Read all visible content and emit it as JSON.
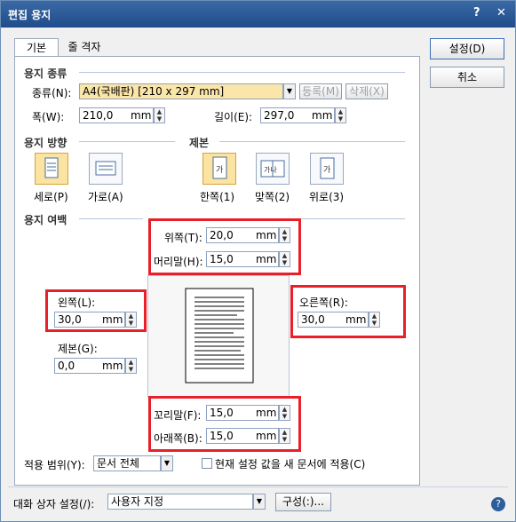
{
  "window": {
    "title": "편집 용지",
    "help_glyph": "?",
    "close_glyph": "✕"
  },
  "tabs": {
    "basic": "기본",
    "grid": "줄 격자"
  },
  "buttons": {
    "ok": "설정(D)",
    "cancel": "취소",
    "register": "등록(M)",
    "delete": "삭제(X)",
    "config": "구성(:)..."
  },
  "paper_type": {
    "section_title": "용지 종류",
    "kind_label": "종류(N):",
    "kind_value": "A4(국배판) [210 x 297 mm]",
    "width_label": "폭(W):",
    "width_value": "210,0",
    "height_label": "길이(E):",
    "height_value": "297,0",
    "unit": "mm"
  },
  "orientation": {
    "section_title": "용지 방향",
    "portrait": "세로(P)",
    "landscape": "가로(A)",
    "portrait_icon": "portrait-page-icon",
    "landscape_icon": "landscape-page-icon"
  },
  "binding": {
    "section_title": "제본",
    "single": "한쪽(1)",
    "facing": "맞쪽(2)",
    "top": "위로(3)",
    "single_glyph": "가",
    "facing_glyph": "가나",
    "top_glyph": "가"
  },
  "margins": {
    "section_title": "용지 여백",
    "top_label": "위쪽(T):",
    "top_value": "20,0",
    "header_label": "머리말(H):",
    "header_value": "15,0",
    "left_label": "왼쪽(L):",
    "left_value": "30,0",
    "right_label": "오른쪽(R):",
    "right_value": "30,0",
    "gutter_label": "제본(G):",
    "gutter_value": "0,0",
    "footer_label": "꼬리말(F):",
    "footer_value": "15,0",
    "bottom_label": "아래쪽(B):",
    "bottom_value": "15,0",
    "unit": "mm"
  },
  "apply": {
    "range_label": "적용 범위(Y):",
    "range_value": "문서 전체",
    "new_doc_label": "현재 설정 값을 새 문서에 적용(C)"
  },
  "dialog_settings": {
    "label": "대화 상자 설정(/):",
    "value": "사용자 지정"
  },
  "colors": {
    "title_bar": "#2a5896",
    "highlight_box": "#e8202a",
    "selected_option": "#fbe3a2"
  }
}
